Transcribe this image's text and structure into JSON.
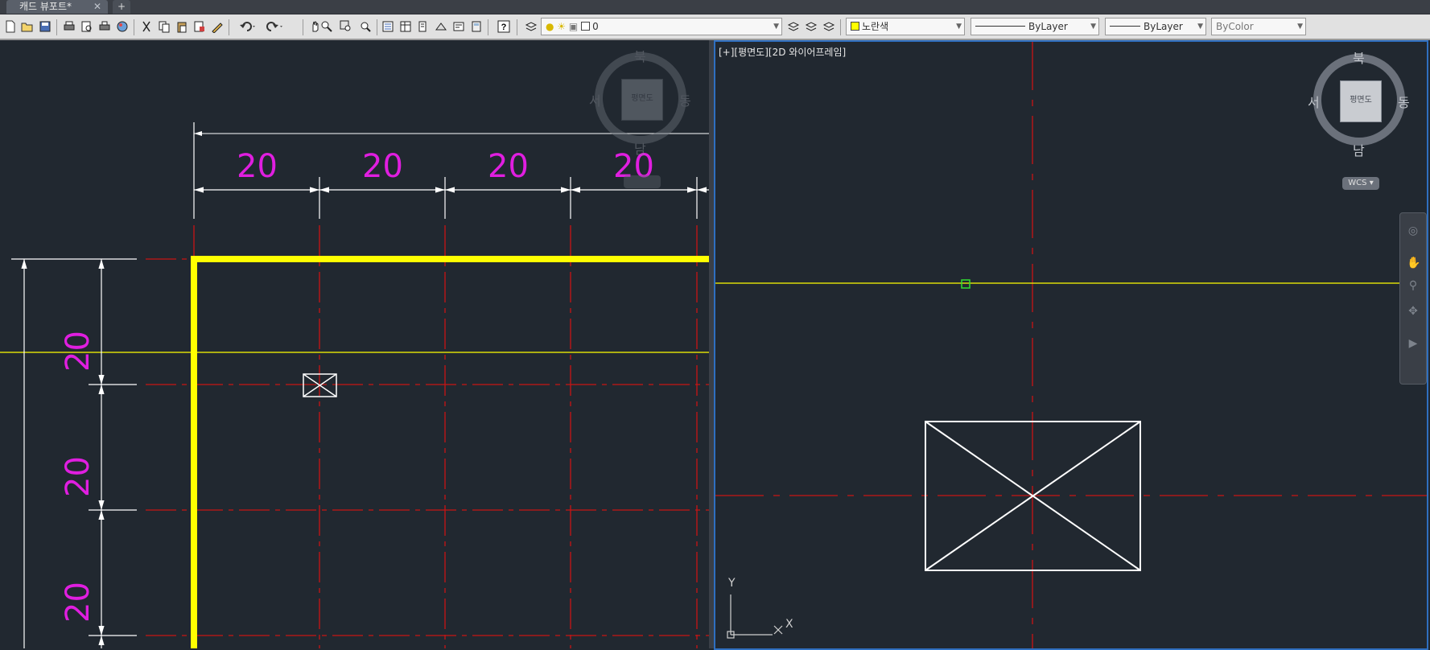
{
  "tabs": {
    "active_label": "캐드 뷰포트*",
    "close_glyph": "✕",
    "new_glyph": "+"
  },
  "toolbar": {
    "layer": {
      "name": "0",
      "color": "#ffffff"
    },
    "color_combo": {
      "value": "노란색",
      "swatch": "#ffff00"
    },
    "linetype_combo": {
      "value": "ByLayer"
    },
    "lineweight_combo": {
      "value": "ByLayer"
    },
    "plotstyle_combo": {
      "value": "ByColor"
    },
    "icons": [
      "new-icon",
      "open-icon",
      "save-icon",
      "plot-icon",
      "plot-preview-icon",
      "publish-icon",
      "render-icon",
      "cut-icon",
      "copy-icon",
      "paste-icon",
      "match-properties-icon",
      "block-editor-icon",
      "undo-icon",
      "redo-icon",
      "pan-icon",
      "zoom-realtime-icon",
      "zoom-window-icon",
      "zoom-previous-icon",
      "properties-icon",
      "design-center-icon",
      "tool-palettes-icon",
      "sheet-set-icon",
      "markup-icon",
      "calculator-icon",
      "help-icon",
      "layer-properties-icon"
    ]
  },
  "left_viewport": {
    "dimension_labels": {
      "horizontal": [
        "20",
        "20",
        "20",
        "20"
      ],
      "vertical": [
        "20",
        "20",
        "20"
      ]
    },
    "compass": {
      "north": "북",
      "south": "남",
      "east": "동",
      "west": "서",
      "cube": "평면도"
    }
  },
  "right_viewport": {
    "label": "[+][평면도][2D 와이어프레임]",
    "compass": {
      "north": "북",
      "south": "남",
      "east": "동",
      "west": "서",
      "cube": "평면도"
    },
    "wcs_label": "WCS",
    "ucs": {
      "x_label": "X",
      "y_label": "Y"
    }
  },
  "colors": {
    "background": "#212830",
    "wall": "#ffff00",
    "center_line": "#c81414",
    "dimension_text": "#e01ee0",
    "viewport_border": "#2f6fc0"
  }
}
